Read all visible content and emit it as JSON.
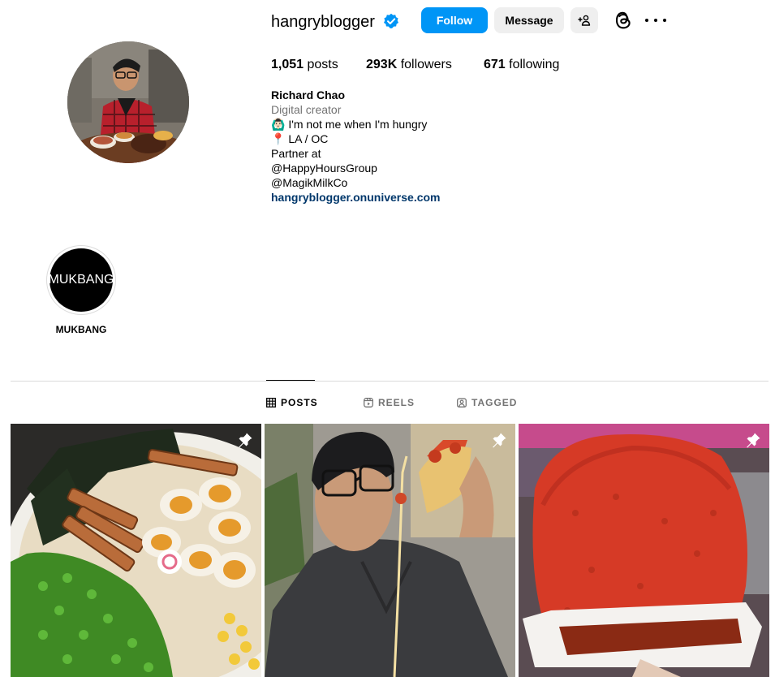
{
  "profile": {
    "username": "hangryblogger",
    "follow_label": "Follow",
    "message_label": "Message",
    "stats": {
      "posts_count": "1,051",
      "posts_label": " posts",
      "followers_count": "293K",
      "followers_label": " followers",
      "following_count": "671",
      "following_label": " following"
    },
    "bio": {
      "name": "Richard Chao",
      "category": "Digital creator",
      "lines": [
        "🙆🏻‍♂️ I'm not me when I'm hungry",
        "📍 LA / OC",
        "Partner at",
        "@HappyHoursGroup",
        "@MagikMilkCo"
      ],
      "link": "hangryblogger.onuniverse.com"
    }
  },
  "highlights": [
    {
      "cover_text": "MUKBANG",
      "label": "MUKBANG"
    }
  ],
  "tabs": [
    {
      "label": "POSTS",
      "icon": "grid-icon",
      "active": true
    },
    {
      "label": "REELS",
      "icon": "reels-icon",
      "active": false
    },
    {
      "label": "TAGGED",
      "icon": "tagged-icon",
      "active": false
    }
  ],
  "posts": [
    {
      "subject": "ramen bowl",
      "pinned": true
    },
    {
      "subject": "man eating pizza slice",
      "pinned": true
    },
    {
      "subject": "chili-covered watermelon",
      "pinned": true
    }
  ],
  "colors": {
    "follow_button": "#0095f6",
    "secondary_button": "#efefef",
    "verified_badge": "#0095f6",
    "link": "#00376b",
    "muted_text": "#737373",
    "divider": "#dbdbdb"
  }
}
